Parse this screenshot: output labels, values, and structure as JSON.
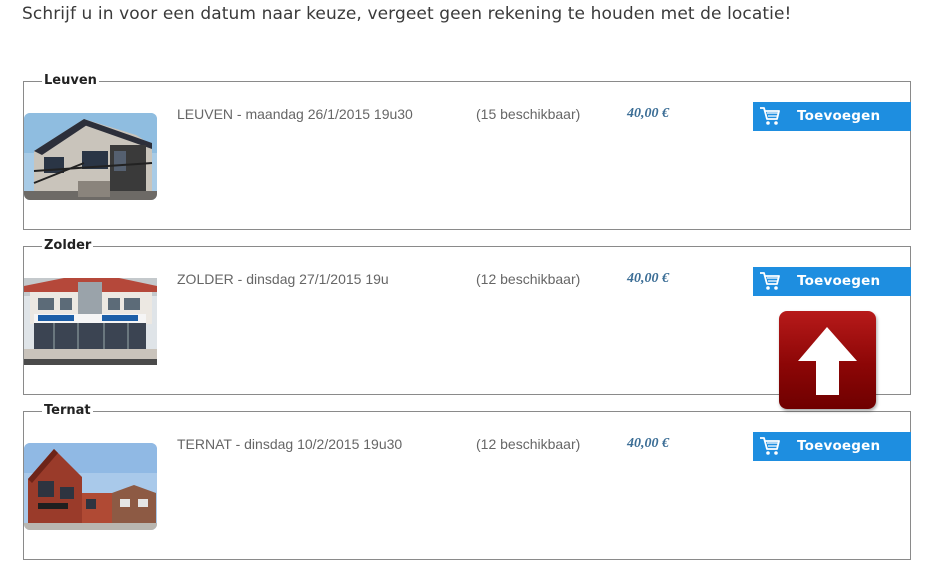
{
  "intro_text": "Schrijf u in voor een datum naar keuze, vergeet geen rekening te houden met de locatie!",
  "sessions": [
    {
      "legend": "Leuven",
      "name": "LEUVEN - maandag 26/1/2015 19u30",
      "availability": "(15 beschikbaar)",
      "price": "40,00 €",
      "button_label": "Toevoegen"
    },
    {
      "legend": "Zolder",
      "name": "ZOLDER - dinsdag 27/1/2015 19u",
      "availability": "(12 beschikbaar)",
      "price": "40,00 €",
      "button_label": "Toevoegen"
    },
    {
      "legend": "Ternat",
      "name": "TERNAT - dinsdag 10/2/2015 19u30",
      "availability": "(12 beschikbaar)",
      "price": "40,00 €",
      "button_label": "Toevoegen"
    }
  ],
  "icons": {
    "cart": "shopping-cart-icon",
    "scroll_top": "arrow-up-icon"
  },
  "colors": {
    "button": "#1e8ee0",
    "price": "#3c6e96",
    "scroll_top": "#9b0c0c"
  }
}
